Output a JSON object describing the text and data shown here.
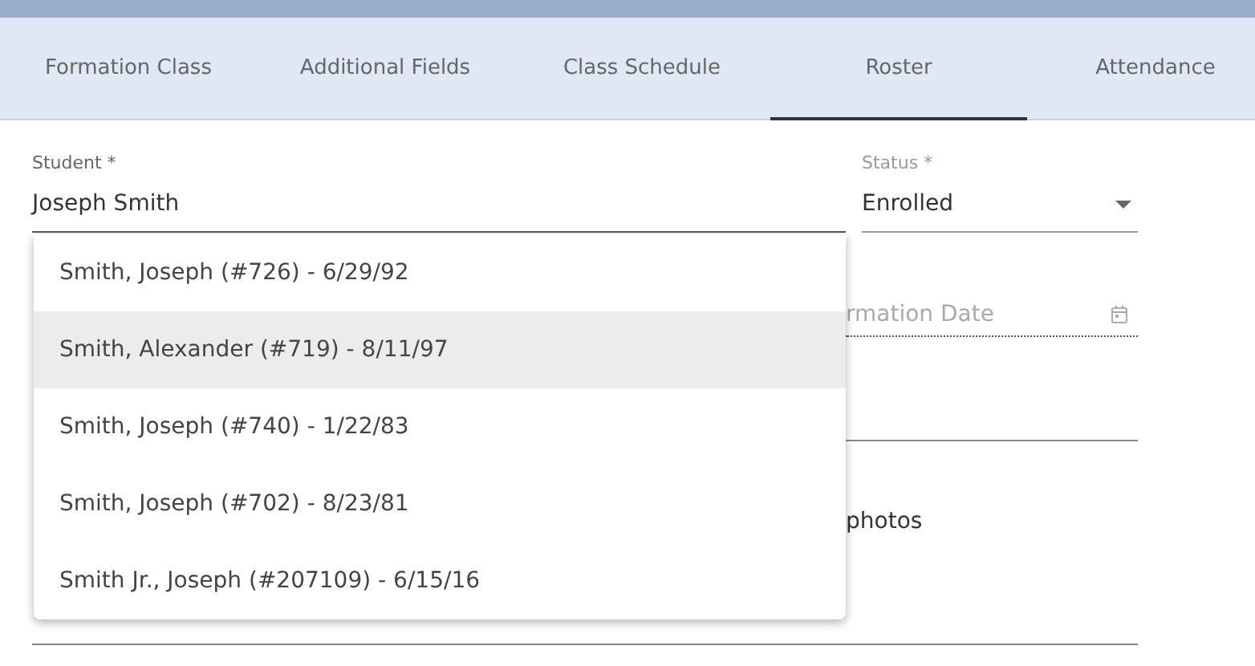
{
  "tabs": [
    {
      "label": "Formation Class",
      "selected": false
    },
    {
      "label": "Additional Fields",
      "selected": false
    },
    {
      "label": "Class Schedule",
      "selected": false
    },
    {
      "label": "Roster",
      "selected": true
    },
    {
      "label": "Attendance",
      "selected": false
    }
  ],
  "student": {
    "label": "Student *",
    "value": "Joseph Smith"
  },
  "status": {
    "label": "Status *",
    "value": "Enrolled"
  },
  "suggestions": [
    {
      "label": "Smith, Joseph (#726) - 6/29/92",
      "highlighted": false
    },
    {
      "label": "Smith, Alexander (#719) - 8/11/97",
      "highlighted": true
    },
    {
      "label": "Smith, Joseph (#740) - 1/22/83",
      "highlighted": false
    },
    {
      "label": "Smith, Joseph (#702) - 8/23/81",
      "highlighted": false
    },
    {
      "label": "Smith Jr., Joseph (#207109) - 6/15/16",
      "highlighted": false
    }
  ],
  "formation_date": {
    "placeholder": "rmation Date"
  },
  "photos_text": "photos"
}
